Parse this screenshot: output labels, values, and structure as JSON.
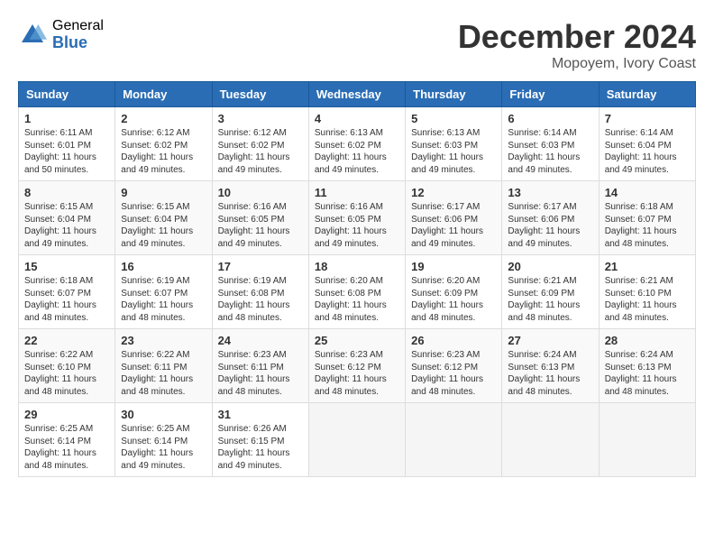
{
  "header": {
    "logo_general": "General",
    "logo_blue": "Blue",
    "month_title": "December 2024",
    "location": "Mopoyem, Ivory Coast"
  },
  "calendar": {
    "days_of_week": [
      "Sunday",
      "Monday",
      "Tuesday",
      "Wednesday",
      "Thursday",
      "Friday",
      "Saturday"
    ],
    "weeks": [
      [
        {
          "day": "1",
          "sunrise": "6:11 AM",
          "sunset": "6:01 PM",
          "daylight": "11 hours and 50 minutes."
        },
        {
          "day": "2",
          "sunrise": "6:12 AM",
          "sunset": "6:02 PM",
          "daylight": "11 hours and 49 minutes."
        },
        {
          "day": "3",
          "sunrise": "6:12 AM",
          "sunset": "6:02 PM",
          "daylight": "11 hours and 49 minutes."
        },
        {
          "day": "4",
          "sunrise": "6:13 AM",
          "sunset": "6:02 PM",
          "daylight": "11 hours and 49 minutes."
        },
        {
          "day": "5",
          "sunrise": "6:13 AM",
          "sunset": "6:03 PM",
          "daylight": "11 hours and 49 minutes."
        },
        {
          "day": "6",
          "sunrise": "6:14 AM",
          "sunset": "6:03 PM",
          "daylight": "11 hours and 49 minutes."
        },
        {
          "day": "7",
          "sunrise": "6:14 AM",
          "sunset": "6:04 PM",
          "daylight": "11 hours and 49 minutes."
        }
      ],
      [
        {
          "day": "8",
          "sunrise": "6:15 AM",
          "sunset": "6:04 PM",
          "daylight": "11 hours and 49 minutes."
        },
        {
          "day": "9",
          "sunrise": "6:15 AM",
          "sunset": "6:04 PM",
          "daylight": "11 hours and 49 minutes."
        },
        {
          "day": "10",
          "sunrise": "6:16 AM",
          "sunset": "6:05 PM",
          "daylight": "11 hours and 49 minutes."
        },
        {
          "day": "11",
          "sunrise": "6:16 AM",
          "sunset": "6:05 PM",
          "daylight": "11 hours and 49 minutes."
        },
        {
          "day": "12",
          "sunrise": "6:17 AM",
          "sunset": "6:06 PM",
          "daylight": "11 hours and 49 minutes."
        },
        {
          "day": "13",
          "sunrise": "6:17 AM",
          "sunset": "6:06 PM",
          "daylight": "11 hours and 49 minutes."
        },
        {
          "day": "14",
          "sunrise": "6:18 AM",
          "sunset": "6:07 PM",
          "daylight": "11 hours and 48 minutes."
        }
      ],
      [
        {
          "day": "15",
          "sunrise": "6:18 AM",
          "sunset": "6:07 PM",
          "daylight": "11 hours and 48 minutes."
        },
        {
          "day": "16",
          "sunrise": "6:19 AM",
          "sunset": "6:07 PM",
          "daylight": "11 hours and 48 minutes."
        },
        {
          "day": "17",
          "sunrise": "6:19 AM",
          "sunset": "6:08 PM",
          "daylight": "11 hours and 48 minutes."
        },
        {
          "day": "18",
          "sunrise": "6:20 AM",
          "sunset": "6:08 PM",
          "daylight": "11 hours and 48 minutes."
        },
        {
          "day": "19",
          "sunrise": "6:20 AM",
          "sunset": "6:09 PM",
          "daylight": "11 hours and 48 minutes."
        },
        {
          "day": "20",
          "sunrise": "6:21 AM",
          "sunset": "6:09 PM",
          "daylight": "11 hours and 48 minutes."
        },
        {
          "day": "21",
          "sunrise": "6:21 AM",
          "sunset": "6:10 PM",
          "daylight": "11 hours and 48 minutes."
        }
      ],
      [
        {
          "day": "22",
          "sunrise": "6:22 AM",
          "sunset": "6:10 PM",
          "daylight": "11 hours and 48 minutes."
        },
        {
          "day": "23",
          "sunrise": "6:22 AM",
          "sunset": "6:11 PM",
          "daylight": "11 hours and 48 minutes."
        },
        {
          "day": "24",
          "sunrise": "6:23 AM",
          "sunset": "6:11 PM",
          "daylight": "11 hours and 48 minutes."
        },
        {
          "day": "25",
          "sunrise": "6:23 AM",
          "sunset": "6:12 PM",
          "daylight": "11 hours and 48 minutes."
        },
        {
          "day": "26",
          "sunrise": "6:23 AM",
          "sunset": "6:12 PM",
          "daylight": "11 hours and 48 minutes."
        },
        {
          "day": "27",
          "sunrise": "6:24 AM",
          "sunset": "6:13 PM",
          "daylight": "11 hours and 48 minutes."
        },
        {
          "day": "28",
          "sunrise": "6:24 AM",
          "sunset": "6:13 PM",
          "daylight": "11 hours and 48 minutes."
        }
      ],
      [
        {
          "day": "29",
          "sunrise": "6:25 AM",
          "sunset": "6:14 PM",
          "daylight": "11 hours and 48 minutes."
        },
        {
          "day": "30",
          "sunrise": "6:25 AM",
          "sunset": "6:14 PM",
          "daylight": "11 hours and 49 minutes."
        },
        {
          "day": "31",
          "sunrise": "6:26 AM",
          "sunset": "6:15 PM",
          "daylight": "11 hours and 49 minutes."
        },
        null,
        null,
        null,
        null
      ]
    ]
  }
}
